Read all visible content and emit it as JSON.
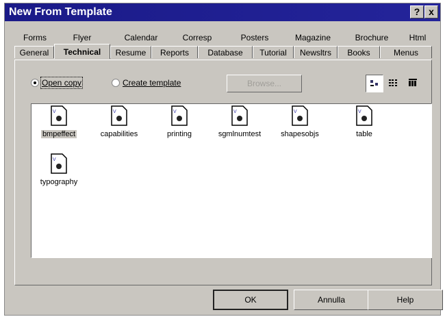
{
  "window": {
    "title": "New From Template",
    "help_label": "?",
    "close_label": "x"
  },
  "tabs_back": [
    "Forms",
    "Flyer",
    "Calendar",
    "Corresp",
    "Posters",
    "Magazine",
    "Brochure",
    "Html"
  ],
  "tabs_front": [
    "General",
    "Technical",
    "Resume",
    "Reports",
    "Database",
    "Tutorial",
    "Newsltrs",
    "Books",
    "Menus"
  ],
  "active_tab": "Technical",
  "options": {
    "open_copy": "Open copy",
    "create_template": "Create template",
    "selected": "Open copy"
  },
  "browse_label": "Browse...",
  "view_buttons": [
    "large-icons",
    "list",
    "details"
  ],
  "files": [
    "bmpeffect",
    "capabilities",
    "printing",
    "sgmlnumtest",
    "shapesobjs",
    "table",
    "typography"
  ],
  "selected_file": "bmpeffect",
  "buttons": {
    "ok": "OK",
    "cancel": "Annulla",
    "help": "Help"
  }
}
